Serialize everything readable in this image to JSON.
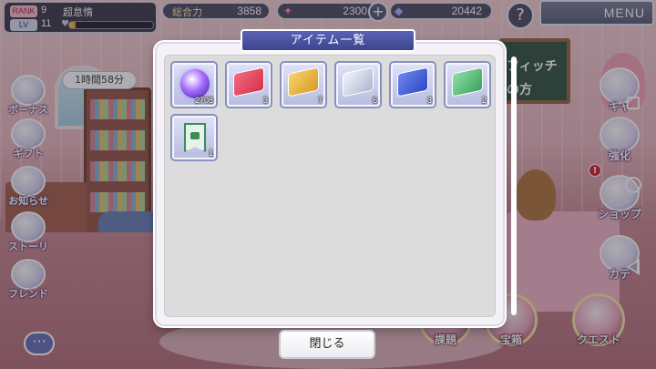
{
  "player": {
    "rank_label": "RANK",
    "rank": "9",
    "lv_label": "LV",
    "level": "11",
    "name": "超怠惰",
    "exp_progress": 0.08
  },
  "stats": {
    "power_label": "総合力",
    "power": "3858",
    "hearts": "2300",
    "gems": "20442"
  },
  "header": {
    "help_label": "?",
    "menu_label": "MENU",
    "plus_label": "+"
  },
  "left_menu": {
    "timer": "1時間58分",
    "items": [
      {
        "label": "ボーナス"
      },
      {
        "label": "ギフト"
      },
      {
        "label": "お知らせ"
      },
      {
        "label": "ストーリー"
      },
      {
        "label": "フレンド"
      }
    ]
  },
  "right_menu": {
    "items": [
      {
        "label": "キャ"
      },
      {
        "label": "強化"
      },
      {
        "label": "ショップ"
      },
      {
        "label": "カテ"
      }
    ],
    "alert_mark": "!"
  },
  "bottom_menu": {
    "items": [
      {
        "label": "課題"
      },
      {
        "label": "宝箱"
      },
      {
        "label": "クエスト"
      }
    ]
  },
  "room": {
    "board_lines": [
      "フィッチ",
      "の方"
    ]
  },
  "modal": {
    "title": "アイテム一覧",
    "close_label": "閉じる",
    "items": [
      {
        "icon": "purple-orb-icon",
        "count": "2708"
      },
      {
        "icon": "red-ticket-icon",
        "count": "3"
      },
      {
        "icon": "gold-ticket-icon",
        "count": "7"
      },
      {
        "icon": "silver-ticket-icon",
        "count": "6"
      },
      {
        "icon": "blue-ticket-icon",
        "count": "3"
      },
      {
        "icon": "green-ticket-icon",
        "count": "2"
      },
      {
        "icon": "green-flag-icon",
        "count": "1"
      }
    ]
  },
  "colors": {
    "title_bar": "#4b52a3",
    "red_ticket": "#e8475f",
    "gold_ticket": "#e8b83a",
    "silver_ticket": "#c9d0e4",
    "blue_ticket": "#3f5bd6",
    "green_ticket": "#4fb86b"
  }
}
